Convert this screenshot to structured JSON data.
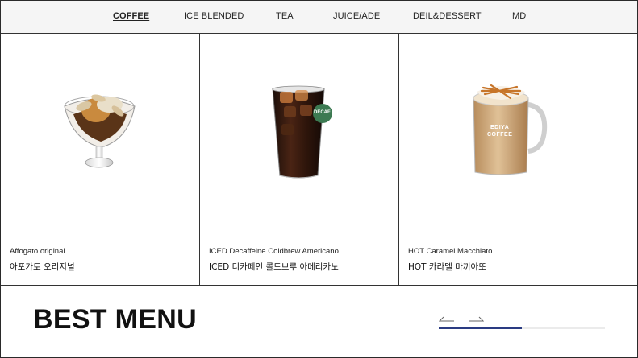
{
  "nav": {
    "items": [
      {
        "label": "COFFEE",
        "active": true
      },
      {
        "label": "ICE BLENDED",
        "active": false
      },
      {
        "label": "TEA",
        "active": false
      },
      {
        "label": "JUICE/ADE",
        "active": false
      },
      {
        "label": "DEIL&DESSERT",
        "active": false
      },
      {
        "label": "MD",
        "active": false
      }
    ]
  },
  "products": [
    {
      "name_en": "Affogato original",
      "name_ko": "아포가토 오리지널",
      "image": "affogato-glass"
    },
    {
      "name_en": "ICED Decaffeine Coldbrew Americano",
      "name_ko": "ICED 디카페인 콜드브루 아메리카노",
      "image": "iced-americano-glass",
      "badge": "DECAF"
    },
    {
      "name_en": "HOT Caramel Macchiato",
      "name_ko": "HOT 카라멜 마끼아또",
      "image": "caramel-macchiato-mug",
      "mug_text": [
        "EDIYA",
        "COFFEE"
      ]
    }
  ],
  "best_menu": {
    "title": "BEST MENU",
    "prev_icon": "arrow-left-icon",
    "next_icon": "arrow-right-icon",
    "progress": 0.5,
    "accent": "#2a3b82"
  }
}
